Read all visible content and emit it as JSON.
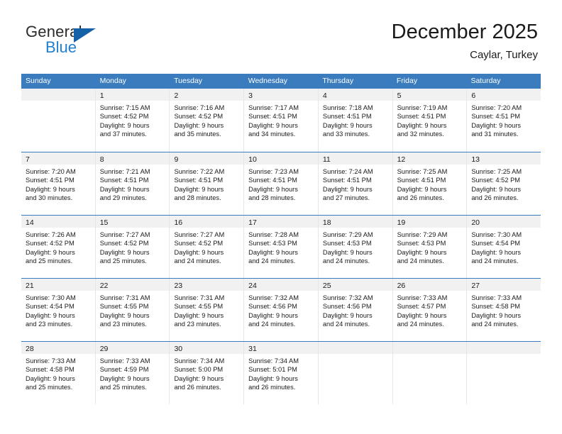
{
  "logo": {
    "word_one": "General",
    "word_two": "Blue",
    "triangle_color": "#1461a8",
    "blue_text_color": "#1f7fd0"
  },
  "header": {
    "title": "December 2025",
    "subtitle": "Caylar, Turkey"
  },
  "theme": {
    "header_blue": "#3a7cbe",
    "daynum_band": "#f1f1f1",
    "cell_border": "#e6e6e6",
    "text": "#1a1a1a"
  },
  "weekdays": [
    "Sunday",
    "Monday",
    "Tuesday",
    "Wednesday",
    "Thursday",
    "Friday",
    "Saturday"
  ],
  "weeks": [
    [
      {
        "day": "",
        "lines": []
      },
      {
        "day": "1",
        "lines": [
          "Sunrise: 7:15 AM",
          "Sunset: 4:52 PM",
          "Daylight: 9 hours",
          "and 37 minutes."
        ]
      },
      {
        "day": "2",
        "lines": [
          "Sunrise: 7:16 AM",
          "Sunset: 4:52 PM",
          "Daylight: 9 hours",
          "and 35 minutes."
        ]
      },
      {
        "day": "3",
        "lines": [
          "Sunrise: 7:17 AM",
          "Sunset: 4:51 PM",
          "Daylight: 9 hours",
          "and 34 minutes."
        ]
      },
      {
        "day": "4",
        "lines": [
          "Sunrise: 7:18 AM",
          "Sunset: 4:51 PM",
          "Daylight: 9 hours",
          "and 33 minutes."
        ]
      },
      {
        "day": "5",
        "lines": [
          "Sunrise: 7:19 AM",
          "Sunset: 4:51 PM",
          "Daylight: 9 hours",
          "and 32 minutes."
        ]
      },
      {
        "day": "6",
        "lines": [
          "Sunrise: 7:20 AM",
          "Sunset: 4:51 PM",
          "Daylight: 9 hours",
          "and 31 minutes."
        ]
      }
    ],
    [
      {
        "day": "7",
        "lines": [
          "Sunrise: 7:20 AM",
          "Sunset: 4:51 PM",
          "Daylight: 9 hours",
          "and 30 minutes."
        ]
      },
      {
        "day": "8",
        "lines": [
          "Sunrise: 7:21 AM",
          "Sunset: 4:51 PM",
          "Daylight: 9 hours",
          "and 29 minutes."
        ]
      },
      {
        "day": "9",
        "lines": [
          "Sunrise: 7:22 AM",
          "Sunset: 4:51 PM",
          "Daylight: 9 hours",
          "and 28 minutes."
        ]
      },
      {
        "day": "10",
        "lines": [
          "Sunrise: 7:23 AM",
          "Sunset: 4:51 PM",
          "Daylight: 9 hours",
          "and 28 minutes."
        ]
      },
      {
        "day": "11",
        "lines": [
          "Sunrise: 7:24 AM",
          "Sunset: 4:51 PM",
          "Daylight: 9 hours",
          "and 27 minutes."
        ]
      },
      {
        "day": "12",
        "lines": [
          "Sunrise: 7:25 AM",
          "Sunset: 4:51 PM",
          "Daylight: 9 hours",
          "and 26 minutes."
        ]
      },
      {
        "day": "13",
        "lines": [
          "Sunrise: 7:25 AM",
          "Sunset: 4:52 PM",
          "Daylight: 9 hours",
          "and 26 minutes."
        ]
      }
    ],
    [
      {
        "day": "14",
        "lines": [
          "Sunrise: 7:26 AM",
          "Sunset: 4:52 PM",
          "Daylight: 9 hours",
          "and 25 minutes."
        ]
      },
      {
        "day": "15",
        "lines": [
          "Sunrise: 7:27 AM",
          "Sunset: 4:52 PM",
          "Daylight: 9 hours",
          "and 25 minutes."
        ]
      },
      {
        "day": "16",
        "lines": [
          "Sunrise: 7:27 AM",
          "Sunset: 4:52 PM",
          "Daylight: 9 hours",
          "and 24 minutes."
        ]
      },
      {
        "day": "17",
        "lines": [
          "Sunrise: 7:28 AM",
          "Sunset: 4:53 PM",
          "Daylight: 9 hours",
          "and 24 minutes."
        ]
      },
      {
        "day": "18",
        "lines": [
          "Sunrise: 7:29 AM",
          "Sunset: 4:53 PM",
          "Daylight: 9 hours",
          "and 24 minutes."
        ]
      },
      {
        "day": "19",
        "lines": [
          "Sunrise: 7:29 AM",
          "Sunset: 4:53 PM",
          "Daylight: 9 hours",
          "and 24 minutes."
        ]
      },
      {
        "day": "20",
        "lines": [
          "Sunrise: 7:30 AM",
          "Sunset: 4:54 PM",
          "Daylight: 9 hours",
          "and 24 minutes."
        ]
      }
    ],
    [
      {
        "day": "21",
        "lines": [
          "Sunrise: 7:30 AM",
          "Sunset: 4:54 PM",
          "Daylight: 9 hours",
          "and 23 minutes."
        ]
      },
      {
        "day": "22",
        "lines": [
          "Sunrise: 7:31 AM",
          "Sunset: 4:55 PM",
          "Daylight: 9 hours",
          "and 23 minutes."
        ]
      },
      {
        "day": "23",
        "lines": [
          "Sunrise: 7:31 AM",
          "Sunset: 4:55 PM",
          "Daylight: 9 hours",
          "and 23 minutes."
        ]
      },
      {
        "day": "24",
        "lines": [
          "Sunrise: 7:32 AM",
          "Sunset: 4:56 PM",
          "Daylight: 9 hours",
          "and 24 minutes."
        ]
      },
      {
        "day": "25",
        "lines": [
          "Sunrise: 7:32 AM",
          "Sunset: 4:56 PM",
          "Daylight: 9 hours",
          "and 24 minutes."
        ]
      },
      {
        "day": "26",
        "lines": [
          "Sunrise: 7:33 AM",
          "Sunset: 4:57 PM",
          "Daylight: 9 hours",
          "and 24 minutes."
        ]
      },
      {
        "day": "27",
        "lines": [
          "Sunrise: 7:33 AM",
          "Sunset: 4:58 PM",
          "Daylight: 9 hours",
          "and 24 minutes."
        ]
      }
    ],
    [
      {
        "day": "28",
        "lines": [
          "Sunrise: 7:33 AM",
          "Sunset: 4:58 PM",
          "Daylight: 9 hours",
          "and 25 minutes."
        ]
      },
      {
        "day": "29",
        "lines": [
          "Sunrise: 7:33 AM",
          "Sunset: 4:59 PM",
          "Daylight: 9 hours",
          "and 25 minutes."
        ]
      },
      {
        "day": "30",
        "lines": [
          "Sunrise: 7:34 AM",
          "Sunset: 5:00 PM",
          "Daylight: 9 hours",
          "and 26 minutes."
        ]
      },
      {
        "day": "31",
        "lines": [
          "Sunrise: 7:34 AM",
          "Sunset: 5:01 PM",
          "Daylight: 9 hours",
          "and 26 minutes."
        ]
      },
      {
        "day": "",
        "lines": []
      },
      {
        "day": "",
        "lines": []
      },
      {
        "day": "",
        "lines": []
      }
    ]
  ]
}
